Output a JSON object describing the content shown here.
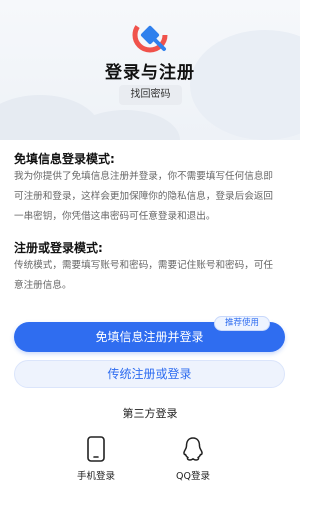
{
  "header": {
    "title": "登录与注册",
    "find_password": "找回密码"
  },
  "sections": [
    {
      "heading": "免填信息登录模式:",
      "body_lines": [
        "我为你提供了免填信息注册并登录，你不需要填写任何信息即",
        "可注册和登录，这样会更加保障你的隐私信息，登录后会返回",
        "一串密钥，你凭借这串密码可任意登录和退出。"
      ]
    },
    {
      "heading": "注册或登录模式:",
      "body_lines": [
        "传统模式，需要填写账号和密码，需要记住账号和密码，可任",
        "意注册信息。"
      ]
    }
  ],
  "actions": {
    "primary_label": "免填信息注册并登录",
    "recommended_badge": "推荐使用",
    "secondary_label": "传统注册或登录"
  },
  "third_party": {
    "title": "第三方登录",
    "options": [
      {
        "label": "手机登录",
        "icon": "phone-icon"
      },
      {
        "label": "QQ登录",
        "icon": "qq-icon"
      }
    ]
  },
  "colors": {
    "accent": "#2f6df0",
    "logo_red": "#f0524b",
    "logo_blue": "#2f80ed"
  }
}
